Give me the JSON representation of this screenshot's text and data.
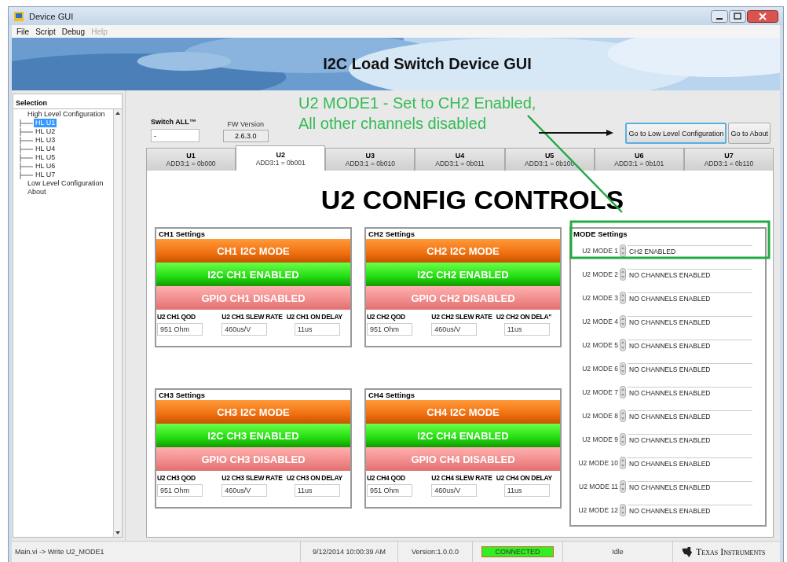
{
  "window": {
    "title": "Device GUI"
  },
  "menu": [
    {
      "label": "File",
      "disabled": false
    },
    {
      "label": "Script",
      "disabled": false
    },
    {
      "label": "Debug",
      "disabled": false
    },
    {
      "label": "Help",
      "disabled": true
    }
  ],
  "banner": {
    "title": "I2C Load Switch Device GUI"
  },
  "sidebar": {
    "header": "Selection",
    "tree": [
      {
        "label": "High Level Configuration",
        "selected": false,
        "children": [
          {
            "label": "HL U1",
            "selected": true
          },
          {
            "label": "HL U2",
            "selected": false
          },
          {
            "label": "HL U3",
            "selected": false
          },
          {
            "label": "HL U4",
            "selected": false
          },
          {
            "label": "HL U5",
            "selected": false
          },
          {
            "label": "HL U6",
            "selected": false
          },
          {
            "label": "HL U7",
            "selected": false
          }
        ]
      },
      {
        "label": "Low Level Configuration",
        "selected": false
      },
      {
        "label": "About",
        "selected": false
      }
    ]
  },
  "switch_all": {
    "label": "Switch ALL™",
    "value": "-"
  },
  "fw_version": {
    "label": "FW Version",
    "value": "2.6.3.0"
  },
  "buttons": [
    {
      "label": "Go to Low Level Configuration",
      "focused": true
    },
    {
      "label": "Go to About",
      "focused": false
    }
  ],
  "tabs": [
    {
      "label": "U1",
      "address": "ADD3:1 = 0b000",
      "selected": false
    },
    {
      "label": "U2",
      "address": "ADD3:1 = 0b001",
      "selected": true
    },
    {
      "label": "U3",
      "address": "ADD3:1 = 0b010",
      "selected": false
    },
    {
      "label": "U4",
      "address": "ADD3:1 = 0b011",
      "selected": false
    },
    {
      "label": "U5",
      "address": "ADD3:1 = 0b100",
      "selected": false
    },
    {
      "label": "U6",
      "address": "ADD3:1 = 0b101",
      "selected": false
    },
    {
      "label": "U7",
      "address": "ADD3:1 = 0b110",
      "selected": false
    }
  ],
  "config_title": "U2 CONFIG CONTROLS",
  "channels": [
    {
      "title": "CH1 Settings",
      "buttons": [
        {
          "kind": "mode",
          "label": "CH1 I2C MODE"
        },
        {
          "kind": "enabled",
          "label": "I2C CH1 ENABLED"
        },
        {
          "kind": "disabled",
          "label": "GPIO CH1 DISABLED"
        }
      ],
      "fields": [
        {
          "label": "U2 CH1 QOD",
          "value": "951 Ohm"
        },
        {
          "label": "U2 CH1 SLEW RATE",
          "value": "460us/V"
        },
        {
          "label": "U2 CH1 ON DELAY",
          "value": "11us"
        }
      ]
    },
    {
      "title": "CH2 Settings",
      "buttons": [
        {
          "kind": "mode",
          "label": "CH2 I2C MODE"
        },
        {
          "kind": "enabled",
          "label": "I2C CH2 ENABLED"
        },
        {
          "kind": "disabled",
          "label": "GPIO CH2 DISABLED"
        }
      ],
      "fields": [
        {
          "label": "U2 CH2 QOD",
          "value": "951 Ohm"
        },
        {
          "label": "U2 CH2 SLEW RATE",
          "value": "460us/V"
        },
        {
          "label": "U2 CH2 ON DELA\"",
          "value": "11us"
        }
      ]
    },
    {
      "title": "CH3 Settings",
      "buttons": [
        {
          "kind": "mode",
          "label": "CH3 I2C MODE"
        },
        {
          "kind": "enabled",
          "label": "I2C CH3 ENABLED"
        },
        {
          "kind": "disabled",
          "label": "GPIO CH3 DISABLED"
        }
      ],
      "fields": [
        {
          "label": "U2 CH3 QOD",
          "value": "951 Ohm"
        },
        {
          "label": "U2 CH3 SLEW RATE",
          "value": "460us/V"
        },
        {
          "label": "U2 CH3 ON DELAY",
          "value": "11us"
        }
      ]
    },
    {
      "title": "CH4 Settings",
      "buttons": [
        {
          "kind": "mode",
          "label": "CH4 I2C MODE"
        },
        {
          "kind": "enabled",
          "label": "I2C CH4 ENABLED"
        },
        {
          "kind": "disabled",
          "label": "GPIO CH4 DISABLED"
        }
      ],
      "fields": [
        {
          "label": "U2 CH4 QOD",
          "value": "951 Ohm"
        },
        {
          "label": "U2 CH4 SLEW RATE",
          "value": "460us/V"
        },
        {
          "label": "U2 CH4 ON DELAY",
          "value": "11us"
        }
      ]
    }
  ],
  "mode_settings": {
    "title": "MODE Settings",
    "modes": [
      {
        "label": "U2 MODE 1",
        "value": "CH2 ENABLED"
      },
      {
        "label": "U2 MODE 2",
        "value": "NO CHANNELS ENABLED"
      },
      {
        "label": "U2 MODE 3",
        "value": "NO CHANNELS ENABLED"
      },
      {
        "label": "U2 MODE 4",
        "value": "NO CHANNELS ENABLED"
      },
      {
        "label": "U2 MODE 5",
        "value": "NO CHANNELS ENABLED"
      },
      {
        "label": "U2 MODE 6",
        "value": "NO CHANNELS ENABLED"
      },
      {
        "label": "U2 MODE 7",
        "value": "NO CHANNELS ENABLED"
      },
      {
        "label": "U2 MODE 8",
        "value": "NO CHANNELS ENABLED"
      },
      {
        "label": "U2 MODE 9",
        "value": "NO CHANNELS ENABLED"
      },
      {
        "label": "U2 MODE 10",
        "value": "NO CHANNELS ENABLED"
      },
      {
        "label": "U2 MODE 11",
        "value": "NO CHANNELS ENABLED"
      },
      {
        "label": "U2 MODE 12",
        "value": "NO CHANNELS ENABLED"
      }
    ]
  },
  "annotation": {
    "lines": [
      "U2 MODE1 - Set to CH2 Enabled,",
      "All other channels disabled"
    ]
  },
  "status_bar": {
    "message": "Main.vi -> Write U2_MODE1",
    "timestamp": "9/12/2014 10:00:39 AM",
    "version": "Version:1.0.0.0",
    "connection": {
      "label": "CONNECTED",
      "connected": true
    },
    "state": "Idle",
    "brand": "Texas Instruments"
  }
}
